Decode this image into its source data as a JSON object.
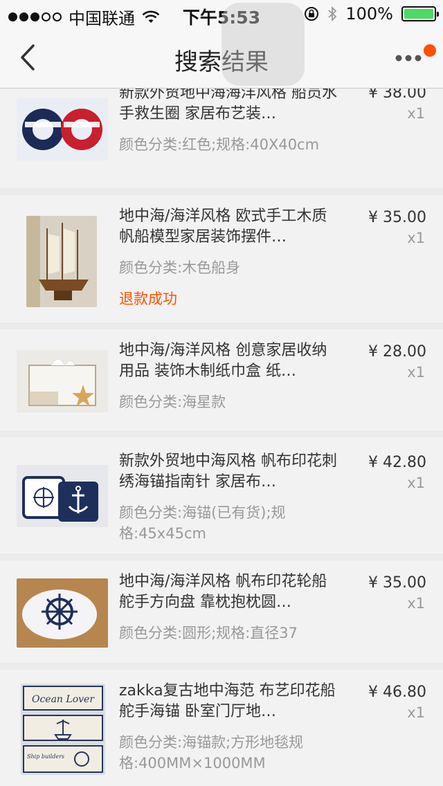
{
  "status_bar": {
    "carrier": "中国联通",
    "time": "下午5:53",
    "battery": "100%"
  },
  "nav": {
    "title": "搜索结果"
  },
  "products": [
    {
      "name": "新款外贸地中海海洋风格 船员水手救生圈 家居布艺装…",
      "spec": "颜色分类:红色;规格:40X40cm",
      "status": "",
      "price": "¥ 38.00",
      "qty": "x1",
      "image": "life-ring-cushions"
    },
    {
      "name": "地中海/海洋风格 欧式手工木质帆船模型家居装饰摆件…",
      "spec": "颜色分类:木色船身",
      "status": "退款成功",
      "price": "¥ 35.00",
      "qty": "x1",
      "image": "sailing-ship-model"
    },
    {
      "name": "地中海/海洋风格 创意家居收纳用品 装饰木制纸巾盒 纸…",
      "spec": "颜色分类:海星款",
      "status": "",
      "price": "¥ 28.00",
      "qty": "x1",
      "image": "wooden-tissue-box"
    },
    {
      "name": "新款外贸地中海风格 帆布印花刺绣海锚指南针 家居布…",
      "spec": "颜色分类:海锚(已有货);规格:45x45cm",
      "status": "",
      "price": "¥ 42.80",
      "qty": "x1",
      "image": "anchor-pillows"
    },
    {
      "name": "地中海/海洋风格 帆布印花轮船舵手方向盘 靠枕抱枕圆…",
      "spec": "颜色分类:圆形;规格:直径37",
      "status": "",
      "price": "¥ 35.00",
      "qty": "x1",
      "image": "ship-wheel-cushion"
    },
    {
      "name": "zakka复古地中海范 布艺印花船舵手海锚 卧室门厅地…",
      "spec": "颜色分类:海锚款;方形地毯规格:400MM×1000MM",
      "status": "",
      "price": "¥ 46.80",
      "qty": "x1",
      "image": "nautical-rug",
      "image_labels": [
        "Ocean Lover",
        "Ship builders"
      ]
    }
  ]
}
